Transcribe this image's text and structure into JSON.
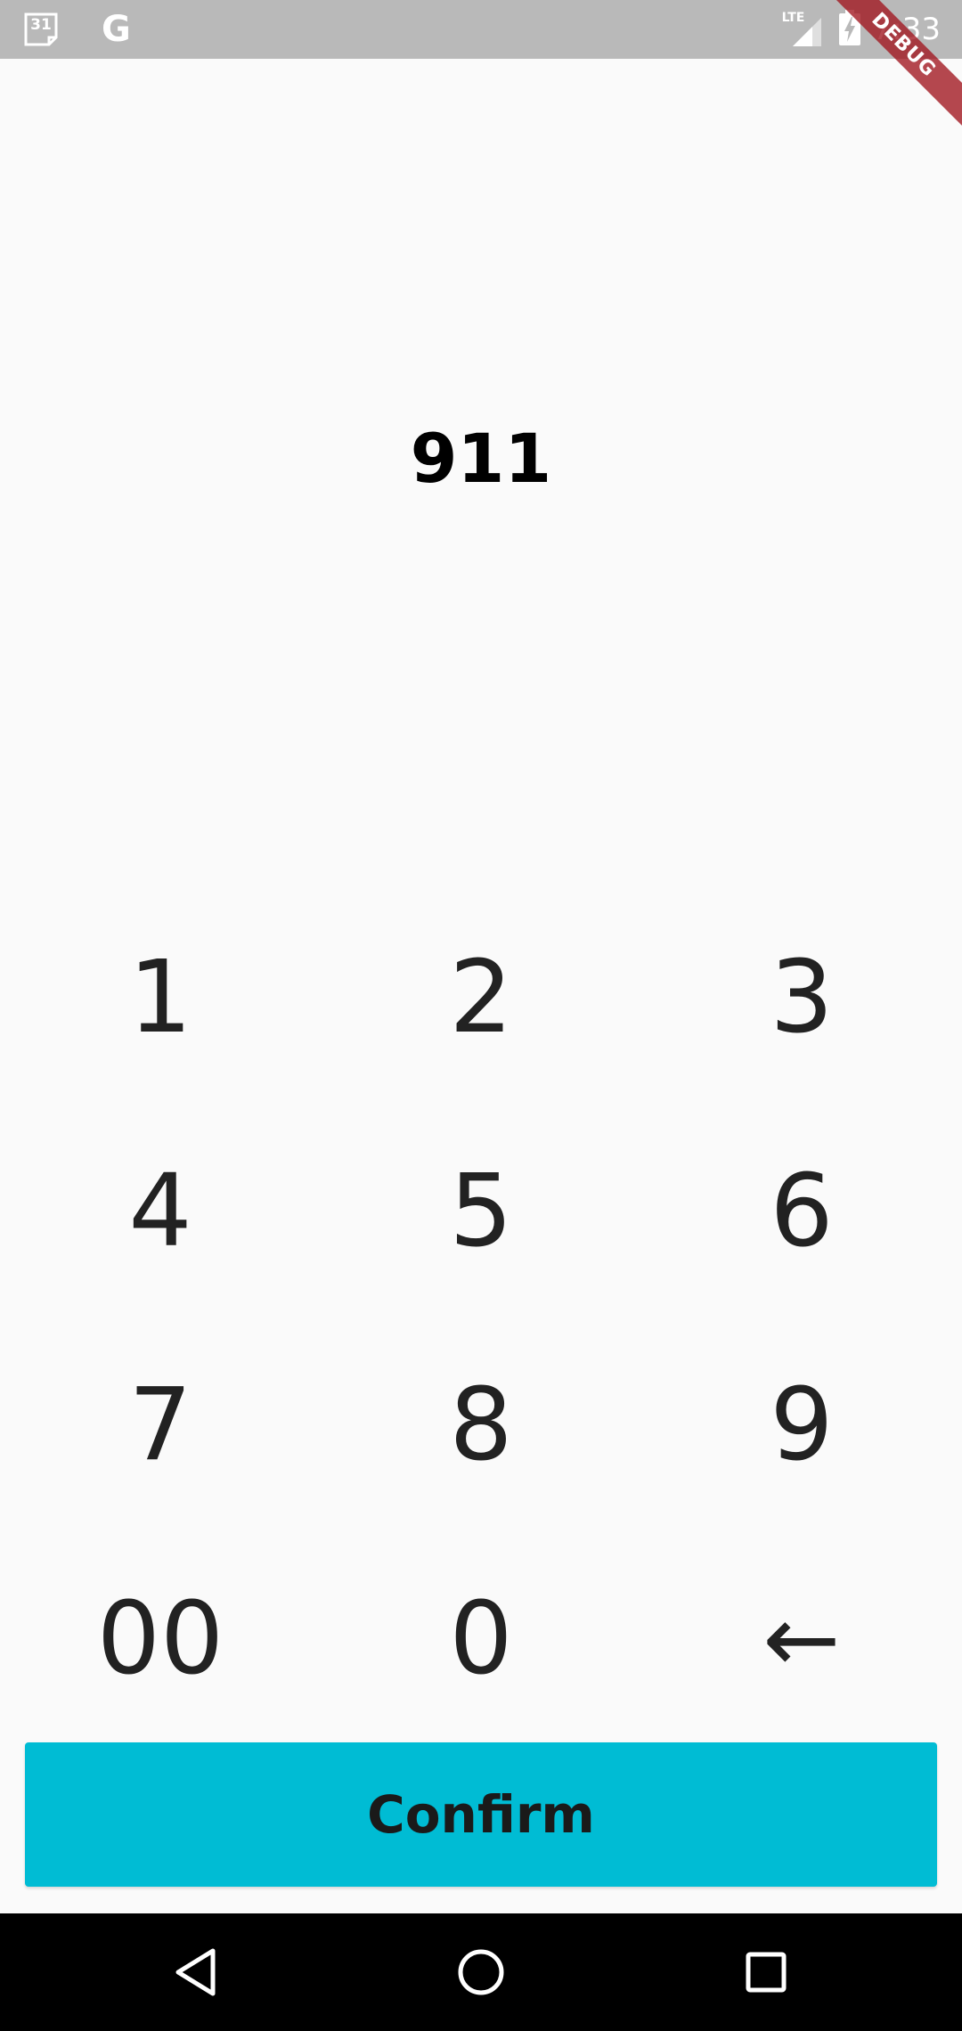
{
  "status_bar": {
    "calendar_day": "31",
    "google_letter": "G",
    "network_type": "LTE",
    "time": "7:33",
    "icons": {
      "calendar": "calendar-icon",
      "google": "google-icon",
      "signal": "signal-icon",
      "battery": "battery-charging-icon"
    }
  },
  "debug_banner": "DEBUG",
  "display": {
    "value": "911"
  },
  "keypad": {
    "keys": [
      "1",
      "2",
      "3",
      "4",
      "5",
      "6",
      "7",
      "8",
      "9",
      "00",
      "0",
      "←"
    ]
  },
  "confirm": {
    "label": "Confirm"
  },
  "nav_bar": {
    "icons": {
      "back": "back-triangle-icon",
      "home": "home-circle-icon",
      "recents": "recents-square-icon"
    }
  },
  "colors": {
    "status_bar_bg": "#b9b9b9",
    "background": "#fafafa",
    "accent": "#00bcd4",
    "key_text": "#222222",
    "debug_ribbon": "#a0141e",
    "nav_bar_bg": "#000000"
  }
}
